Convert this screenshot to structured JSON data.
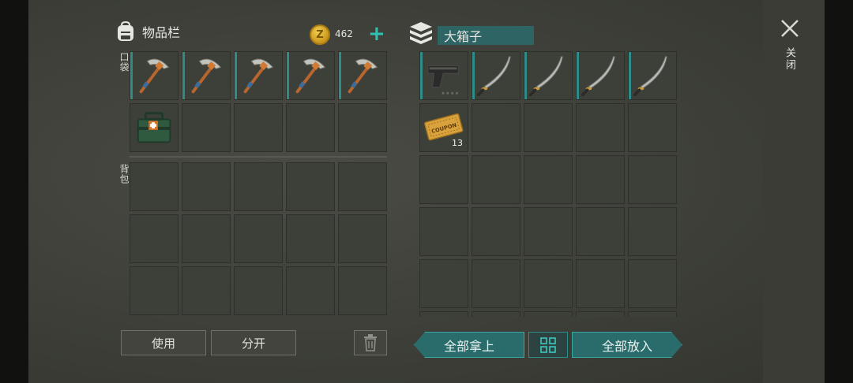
{
  "inventory": {
    "title": "物品栏",
    "bag_icon": "backpack-icon",
    "coin_icon": "coin-icon",
    "coin_symbol": "Z",
    "coin_count": "462",
    "add_icon": "plus-icon",
    "add_label": "+",
    "pocket_label": "口袋",
    "backpack_label": "背包",
    "pocket_slots": [
      "pickaxe",
      "pickaxe",
      "pickaxe",
      "pickaxe",
      "pickaxe",
      "medkit",
      "",
      "",
      "",
      ""
    ],
    "backpack_slots": [
      "",
      "",
      "",
      "",
      "",
      "",
      "",
      "",
      "",
      "",
      "",
      "",
      "",
      "",
      ""
    ]
  },
  "buttons": {
    "use": "使用",
    "split": "分开",
    "trash_icon": "trash-icon",
    "take_all": "全部拿上",
    "sort_icon": "grid-sort-icon",
    "put_all": "全部放入"
  },
  "box": {
    "title": "大箱子",
    "box_icon": "crate-icon",
    "slots": [
      {
        "item": "pistol",
        "qty": ""
      },
      {
        "item": "katana",
        "qty": ""
      },
      {
        "item": "katana",
        "qty": ""
      },
      {
        "item": "katana",
        "qty": ""
      },
      {
        "item": "katana",
        "qty": ""
      },
      {
        "item": "coupon",
        "qty": "13"
      }
    ],
    "coupon_text": "COUPON"
  },
  "close": {
    "icon": "close-icon",
    "label": "关闭"
  },
  "colors": {
    "accent": "#2ec2b2",
    "panel_slot": "#3d3f39",
    "teal_button": "#2a6c6b"
  }
}
